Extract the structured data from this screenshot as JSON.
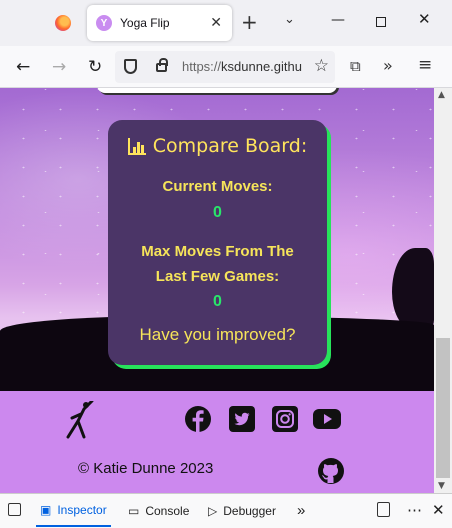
{
  "browser": {
    "tab_title": "Yoga Flip",
    "favicon_letter": "Y",
    "url_prefix": "https://",
    "url_host": "ksdunne.githu"
  },
  "board": {
    "title": "Compare Board:",
    "current_moves_label": "Current Moves:",
    "current_moves_value": "0",
    "max_moves_label_line1": "Max Moves From The",
    "max_moves_label_line2": "Last Few Games:",
    "max_moves_value": "0",
    "improved_text": "Have you improved?"
  },
  "footer": {
    "copyright": "© Katie Dunne 2023",
    "social_icons": [
      "facebook-icon",
      "twitter-icon",
      "instagram-icon",
      "youtube-icon"
    ],
    "github_icon": "github-icon"
  },
  "devtools": {
    "tabs": [
      "Inspector",
      "Console",
      "Debugger"
    ],
    "active_tab": "Inspector"
  },
  "colors": {
    "board_bg": "#4b3567",
    "board_text": "#f6e45a",
    "board_number": "#29e66a",
    "board_shadow": "#27e35b",
    "footer_bg": "#cc88ee"
  }
}
